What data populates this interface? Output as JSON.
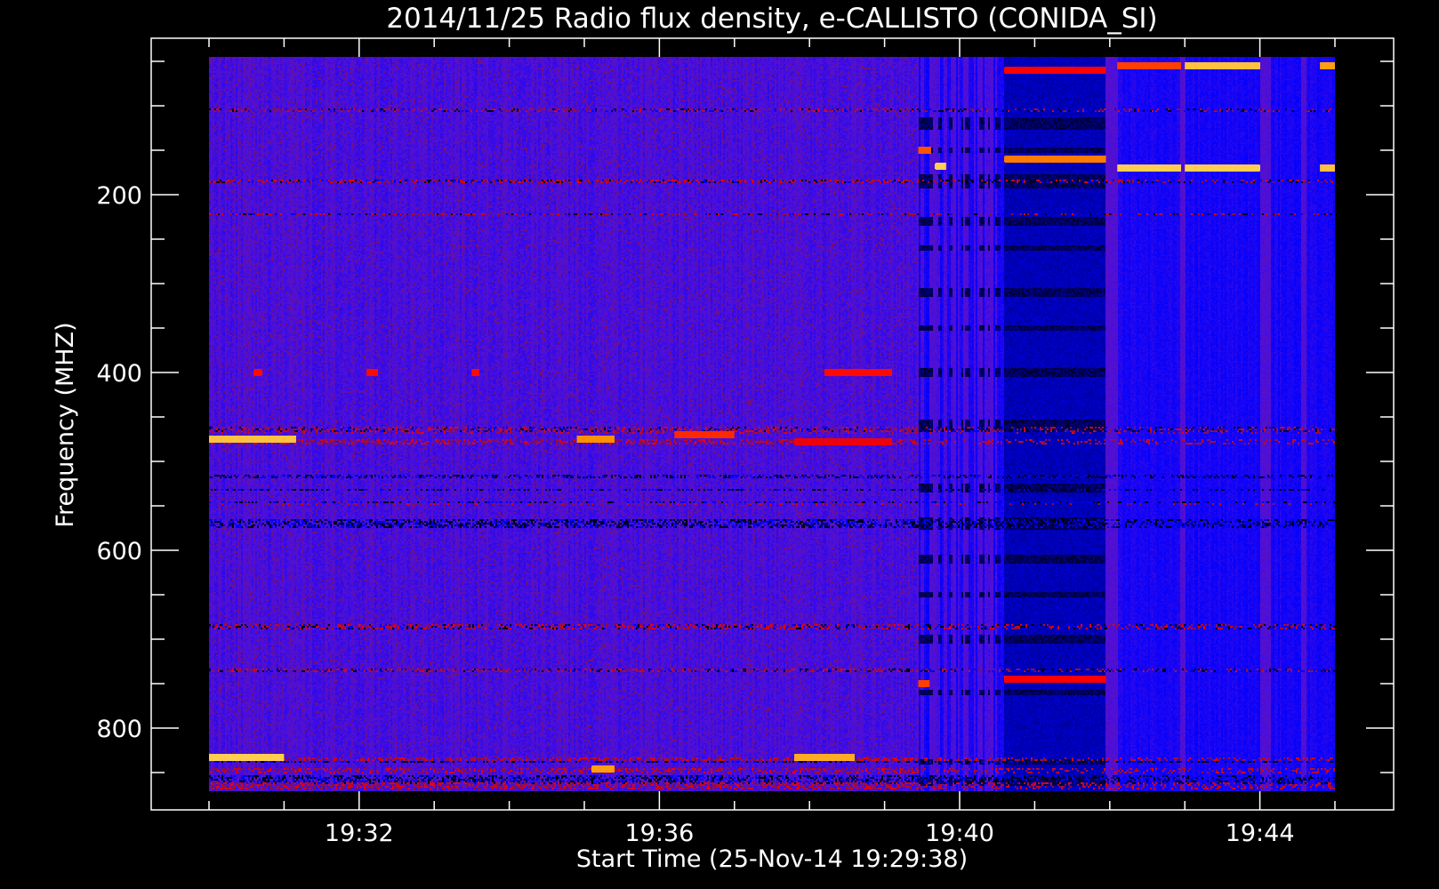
{
  "chart_data": {
    "type": "heatmap",
    "title": "2014/11/25  Radio flux density, e-CALLISTO (CONIDA_SI)",
    "xlabel": "Start Time (25-Nov-14 19:29:38)",
    "ylabel": "Frequency (MHZ)",
    "x_unit": "minutes after 19:30",
    "xlim": [
      -0.1,
      15.75
    ],
    "data_x_range": [
      0,
      15
    ],
    "ylim": [
      892,
      24
    ],
    "data_y_range": [
      45,
      871
    ],
    "x_ticks": [
      {
        "value": 2,
        "label": "19:32"
      },
      {
        "value": 6,
        "label": "19:36"
      },
      {
        "value": 10,
        "label": "19:40"
      },
      {
        "value": 14,
        "label": "19:44"
      }
    ],
    "x_minor_step": 1,
    "y_ticks": [
      {
        "value": 200,
        "label": "200"
      },
      {
        "value": 400,
        "label": "400"
      },
      {
        "value": 600,
        "label": "600"
      },
      {
        "value": 800,
        "label": "800"
      }
    ],
    "y_minor_step": 50,
    "grid": false,
    "colormap": [
      "#000000",
      "#0000ff",
      "#5010d8",
      "#8a1040",
      "#ff0000",
      "#ff9000",
      "#ffff90"
    ],
    "quiet_until_min": 9.45,
    "features": [
      {
        "freq": 475,
        "t0": 0.0,
        "t1": 1.15,
        "level": 0.95
      },
      {
        "freq": 475,
        "t0": 4.9,
        "t1": 5.4,
        "level": 0.88
      },
      {
        "freq": 470,
        "t0": 6.2,
        "t1": 7.0,
        "level": 0.78
      },
      {
        "freq": 478,
        "t0": 7.8,
        "t1": 9.1,
        "level": 0.72
      },
      {
        "freq": 400,
        "t0": 0.6,
        "t1": 0.7,
        "level": 0.75
      },
      {
        "freq": 400,
        "t0": 2.1,
        "t1": 2.25,
        "level": 0.75
      },
      {
        "freq": 400,
        "t0": 3.5,
        "t1": 3.6,
        "level": 0.75
      },
      {
        "freq": 400,
        "t0": 8.2,
        "t1": 9.1,
        "level": 0.75
      },
      {
        "freq": 833,
        "t0": 0.0,
        "t1": 1.0,
        "level": 0.97
      },
      {
        "freq": 833,
        "t0": 7.8,
        "t1": 8.6,
        "level": 0.92
      },
      {
        "freq": 846,
        "t0": 5.1,
        "t1": 5.4,
        "level": 0.9
      },
      {
        "freq": 150,
        "t0": 9.45,
        "t1": 9.62,
        "level": 0.82
      },
      {
        "freq": 168,
        "t0": 9.68,
        "t1": 9.82,
        "level": 0.97
      },
      {
        "freq": 160,
        "t0": 10.6,
        "t1": 11.95,
        "level": 0.86
      },
      {
        "freq": 170,
        "t0": 12.1,
        "t1": 12.95,
        "level": 0.97
      },
      {
        "freq": 170,
        "t0": 13.0,
        "t1": 14.0,
        "level": 0.97
      },
      {
        "freq": 170,
        "t0": 14.8,
        "t1": 15.0,
        "level": 0.95
      },
      {
        "freq": 60,
        "t0": 10.6,
        "t1": 11.95,
        "level": 0.74
      },
      {
        "freq": 55,
        "t0": 12.1,
        "t1": 12.95,
        "level": 0.8
      },
      {
        "freq": 55,
        "t0": 13.0,
        "t1": 14.0,
        "level": 0.95
      },
      {
        "freq": 55,
        "t0": 14.8,
        "t1": 15.0,
        "level": 0.9
      },
      {
        "freq": 745,
        "t0": 10.6,
        "t1": 11.95,
        "level": 0.74
      },
      {
        "freq": 750,
        "t0": 9.45,
        "t1": 9.6,
        "level": 0.8
      }
    ]
  }
}
